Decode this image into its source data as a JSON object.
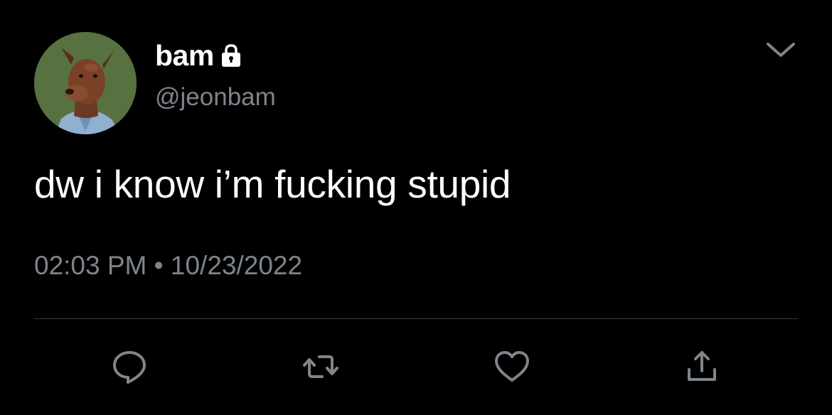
{
  "user": {
    "display_name": "bam",
    "handle": "@jeonbam",
    "avatar": "doberman-avatar",
    "protected_icon": "lock-icon"
  },
  "tweet": {
    "text": "dw i know i’m fucking stupid",
    "timestamp": "02:03 PM • 10/23/2022"
  },
  "menu": {
    "icon": "chevron-down-icon"
  },
  "actions": [
    {
      "name": "reply",
      "icon": "reply-bubble-icon"
    },
    {
      "name": "retweet",
      "icon": "retweet-icon"
    },
    {
      "name": "like",
      "icon": "heart-icon"
    },
    {
      "name": "share",
      "icon": "share-icon"
    }
  ],
  "colors": {
    "background": "#000000",
    "text_primary": "#ffffff",
    "text_secondary": "#7e858b",
    "icon": "#7e858b",
    "divider": "#3b3e42"
  }
}
